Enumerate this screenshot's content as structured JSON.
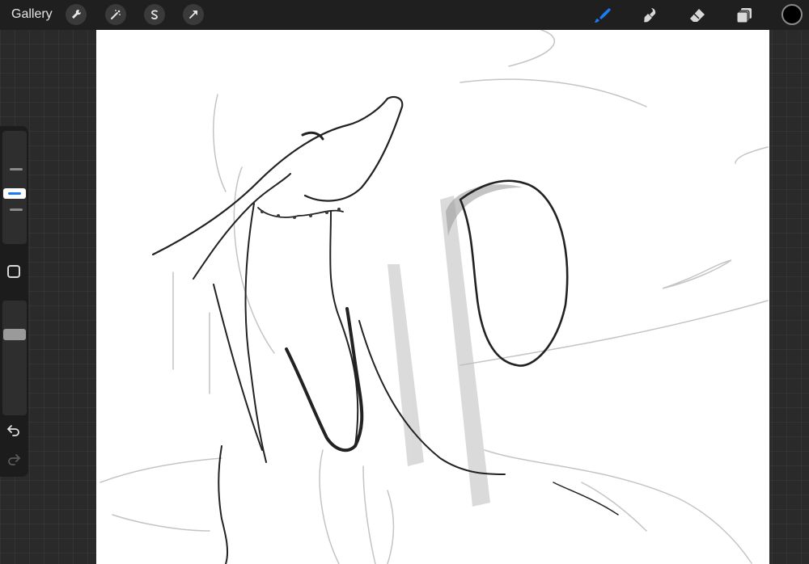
{
  "topbar": {
    "gallery_label": "Gallery",
    "left_tools": [
      "wrench-icon",
      "magic-wand-icon",
      "selection-s-icon",
      "transform-arrow-icon"
    ],
    "right_tools": [
      "brush-icon",
      "smudge-icon",
      "eraser-icon",
      "layers-icon"
    ],
    "active_tool": "brush",
    "current_color": "#000000",
    "accent_color": "#1a7cf0"
  },
  "sidebar": {
    "brush_size_level": 0.56,
    "opacity_level": 0.85,
    "buttons": [
      "modify-square-icon",
      "undo-icon",
      "redo-icon"
    ]
  },
  "canvas": {
    "background": "#ffffff"
  }
}
